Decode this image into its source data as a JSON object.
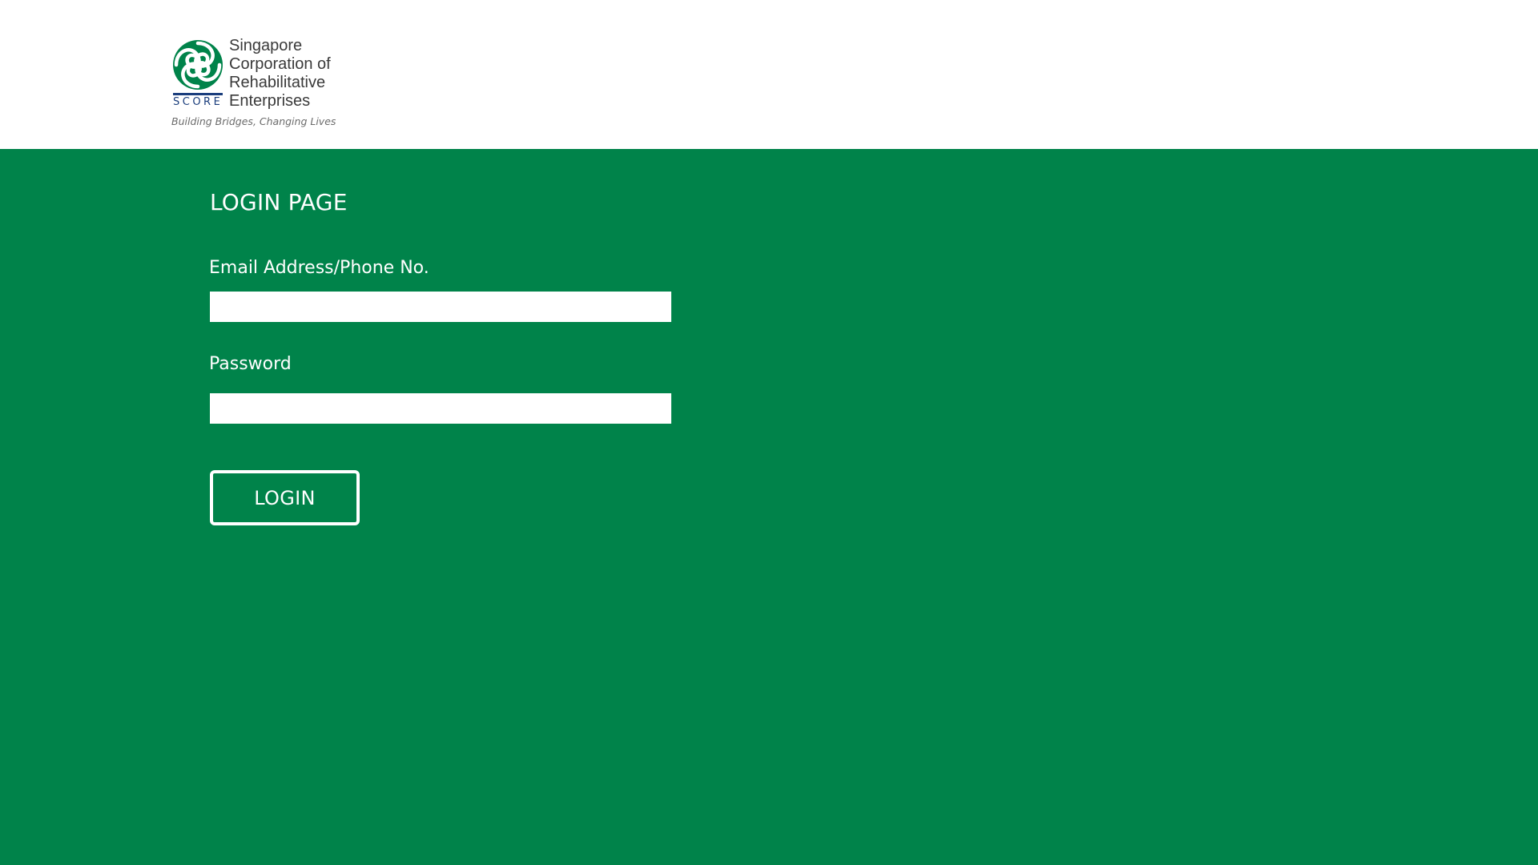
{
  "header": {
    "logo": {
      "name_lines": [
        "Singapore",
        "Corporation of",
        "Rehabilitative",
        "Enterprises"
      ],
      "acronym": "SCORE",
      "tagline": "Building Bridges, Changing Lives",
      "mark_color": "#00834a",
      "acronym_color": "#1a3d7c"
    }
  },
  "main": {
    "background_color": "#00834a",
    "title": "LOGIN PAGE",
    "email_field": {
      "label": "Email Address/Phone No.",
      "value": "",
      "placeholder": ""
    },
    "password_field": {
      "label": "Password",
      "value": "",
      "placeholder": ""
    },
    "login_button": {
      "label": "LOGIN"
    }
  }
}
